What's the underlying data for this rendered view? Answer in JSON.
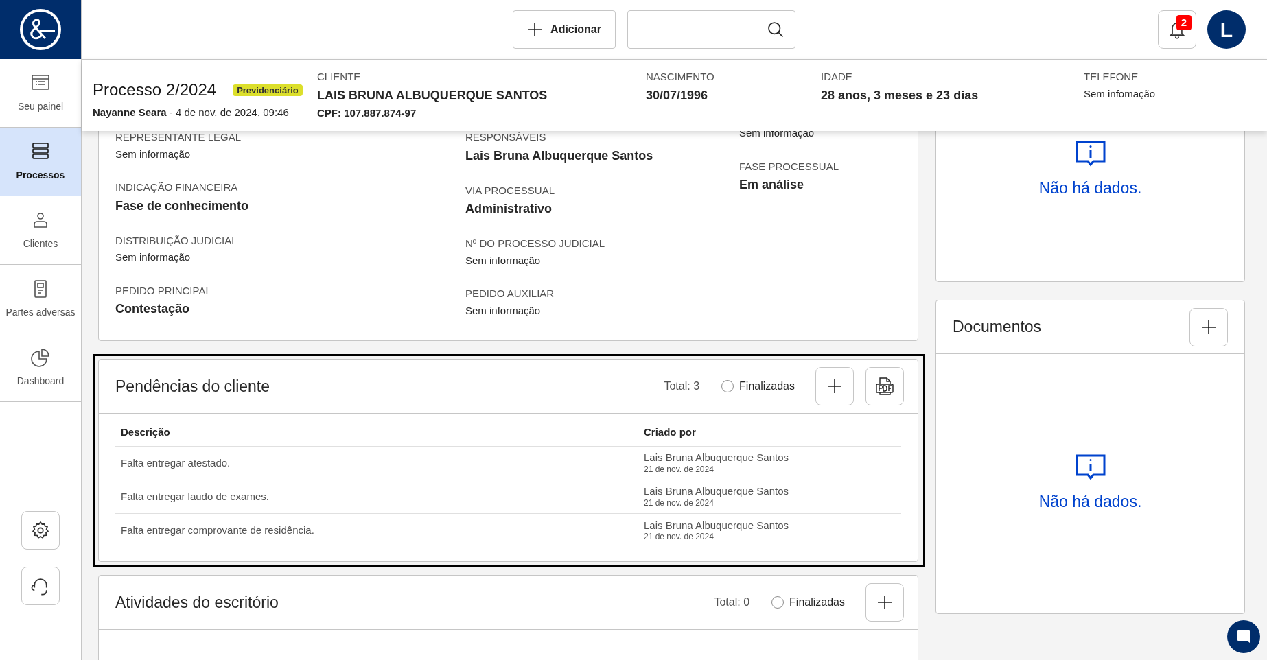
{
  "sidebar": {
    "items": [
      {
        "label": "Seu painel",
        "selected": false
      },
      {
        "label": "Processos",
        "selected": true
      },
      {
        "label": "Clientes",
        "selected": false
      },
      {
        "label": "Partes adversas",
        "selected": false
      },
      {
        "label": "Dashboard",
        "selected": false
      }
    ]
  },
  "topbar": {
    "add_button": "Adicionar",
    "notifications": {
      "count": "2"
    },
    "avatar": "L"
  },
  "header": {
    "title": "Processo 2/2024",
    "tag": "Previdenciário",
    "byline": "**Nayanne Seara** - 4 de nov. de 2024, 09:46",
    "fields": [
      {
        "label": "CLIENTE",
        "value": "LAIS BRUNA ALBUQUERQUE SANTOS",
        "extra": "CPF: 107.887.874-97",
        "emphasis": true
      },
      {
        "label": "NASCIMENTO",
        "value": "30/07/1996",
        "emphasis": true
      },
      {
        "label": "IDADE",
        "value": "28 anos, 3 meses e 23 dias",
        "emphasis": true
      },
      {
        "label": "TELEFONE",
        "value": "Sem infomação",
        "emphasis": false
      }
    ]
  },
  "details": {
    "columns": [
      [
        {
          "label": "REPRESENTANTE LEGAL",
          "value": "Sem informação",
          "emphasis": false
        },
        {
          "label": "INDICAÇÃO FINANCEIRA",
          "value": "Fase de conhecimento",
          "emphasis": true
        },
        {
          "label": "DISTRIBUIÇÃO JUDICIAL",
          "value": "Sem informação",
          "emphasis": false
        },
        {
          "label": "PEDIDO PRINCIPAL",
          "value": "Contestação",
          "emphasis": true
        }
      ],
      [
        {
          "label": "RESPONSÁVEIS",
          "value": "Lais Bruna Albuquerque Santos",
          "emphasis": true
        },
        {
          "label": "VIA PROCESSUAL",
          "value": "Administrativo",
          "emphasis": true
        },
        {
          "label": "Nº DO PROCESSO JUDICIAL",
          "value": "Sem informação",
          "emphasis": false
        },
        {
          "label": "PEDIDO AUXILIAR",
          "value": "Sem informação",
          "emphasis": false
        }
      ],
      [
        {
          "value": "Sem informação",
          "emphasis": false
        },
        {
          "label": "FASE PROCESSUAL",
          "value": "Em análise",
          "emphasis": true
        }
      ]
    ]
  },
  "pendencias": {
    "title": "Pendências do cliente",
    "total": "Total: 3",
    "filter": {
      "label": "Finalizadas",
      "checked": false
    },
    "columns": [
      "Descrição",
      "Criado por"
    ],
    "rows": [
      {
        "description": "Falta entregar atestado.",
        "author": "Lais Bruna Albuquerque Santos",
        "date": "21 de nov. de 2024"
      },
      {
        "description": "Falta entregar laudo de exames.",
        "author": "Lais Bruna Albuquerque Santos",
        "date": "21 de nov. de 2024"
      },
      {
        "description": "Falta entregar comprovante de residência.",
        "author": "Lais Bruna Albuquerque Santos",
        "date": "21 de nov. de 2024"
      }
    ]
  },
  "atividades": {
    "title": "Atividades do escritório",
    "total": "Total: 0",
    "filter": {
      "label": "Finalizadas",
      "checked": false
    }
  },
  "right_top": {
    "empty_message": "Não há dados."
  },
  "documentos": {
    "title": "Documentos",
    "empty_message": "Não há dados."
  }
}
